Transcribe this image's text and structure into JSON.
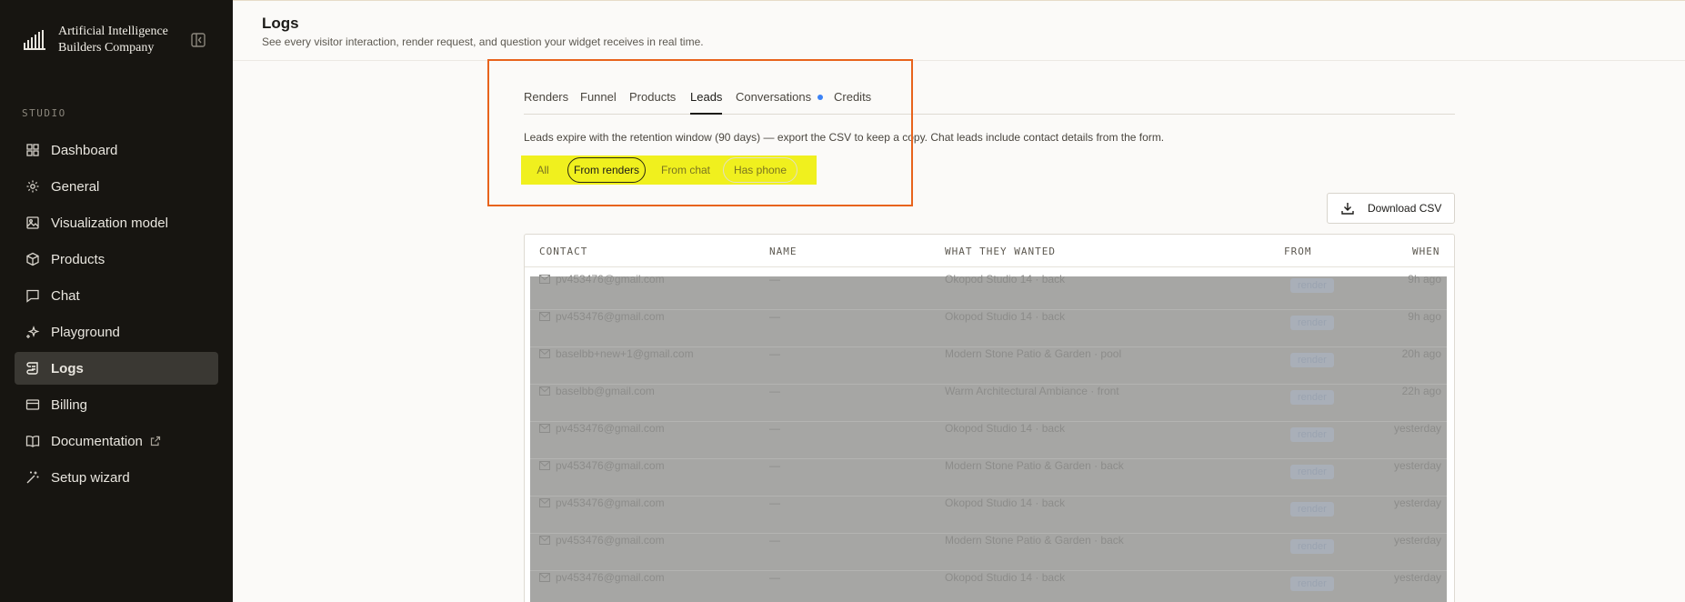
{
  "brand": {
    "line1": "Artificial Intelligence",
    "line2": "Builders Company"
  },
  "sidebar": {
    "section_label": "STUDIO",
    "items": [
      {
        "label": "Dashboard",
        "icon": "grid-icon"
      },
      {
        "label": "General",
        "icon": "gear-icon"
      },
      {
        "label": "Visualization model",
        "icon": "image-icon"
      },
      {
        "label": "Products",
        "icon": "box-icon"
      },
      {
        "label": "Chat",
        "icon": "chat-icon"
      },
      {
        "label": "Playground",
        "icon": "sparkles-icon"
      },
      {
        "label": "Logs",
        "icon": "scroll-icon",
        "active": true
      },
      {
        "label": "Billing",
        "icon": "card-icon"
      },
      {
        "label": "Documentation",
        "icon": "book-icon",
        "external": true
      },
      {
        "label": "Setup wizard",
        "icon": "wand-icon"
      }
    ]
  },
  "header": {
    "title": "Logs",
    "subtitle": "See every visitor interaction, render request, and question your widget receives in real time."
  },
  "tabs": [
    "Renders",
    "Funnel",
    "Products",
    "Leads",
    "Conversations",
    "Credits"
  ],
  "active_tab": "Leads",
  "notice": "Leads expire with the retention window (90 days) — export the CSV to keep a copy. Chat leads include contact details from the form.",
  "filters": [
    "All",
    "From renders",
    "From chat",
    "Has phone"
  ],
  "selected_filter": "From renders",
  "download_label": "Download CSV",
  "table": {
    "columns": [
      "CONTACT",
      "NAME",
      "WHAT THEY WANTED",
      "FROM",
      "WHEN"
    ],
    "rows": [
      {
        "contact": "pv453476@gmail.com",
        "name": "—",
        "wanted": "Okopod Studio 14 · back",
        "from": "render",
        "when": "9h ago"
      },
      {
        "contact": "pv453476@gmail.com",
        "name": "—",
        "wanted": "Okopod Studio 14 · back",
        "from": "render",
        "when": "9h ago"
      },
      {
        "contact": "baselbb+new+1@gmail.com",
        "name": "—",
        "wanted": "Modern Stone Patio & Garden · pool",
        "from": "render",
        "when": "20h ago"
      },
      {
        "contact": "baselbb@gmail.com",
        "name": "—",
        "wanted": "Warm Architectural Ambiance · front",
        "from": "render",
        "when": "22h ago"
      },
      {
        "contact": "pv453476@gmail.com",
        "name": "—",
        "wanted": "Okopod Studio 14 · back",
        "from": "render",
        "when": "yesterday"
      },
      {
        "contact": "pv453476@gmail.com",
        "name": "—",
        "wanted": "Modern Stone Patio & Garden · back",
        "from": "render",
        "when": "yesterday"
      },
      {
        "contact": "pv453476@gmail.com",
        "name": "—",
        "wanted": "Okopod Studio 14 · back",
        "from": "render",
        "when": "yesterday"
      },
      {
        "contact": "pv453476@gmail.com",
        "name": "—",
        "wanted": "Modern Stone Patio & Garden · back",
        "from": "render",
        "when": "yesterday"
      },
      {
        "contact": "pv453476@gmail.com",
        "name": "—",
        "wanted": "Okopod Studio 14 · back",
        "from": "render",
        "when": "yesterday"
      }
    ]
  },
  "colors": {
    "sidebar_bg": "#171511",
    "highlight": "#f0f01e",
    "annotation_box": "#e8631c",
    "status_dot": "#3b82f6"
  }
}
